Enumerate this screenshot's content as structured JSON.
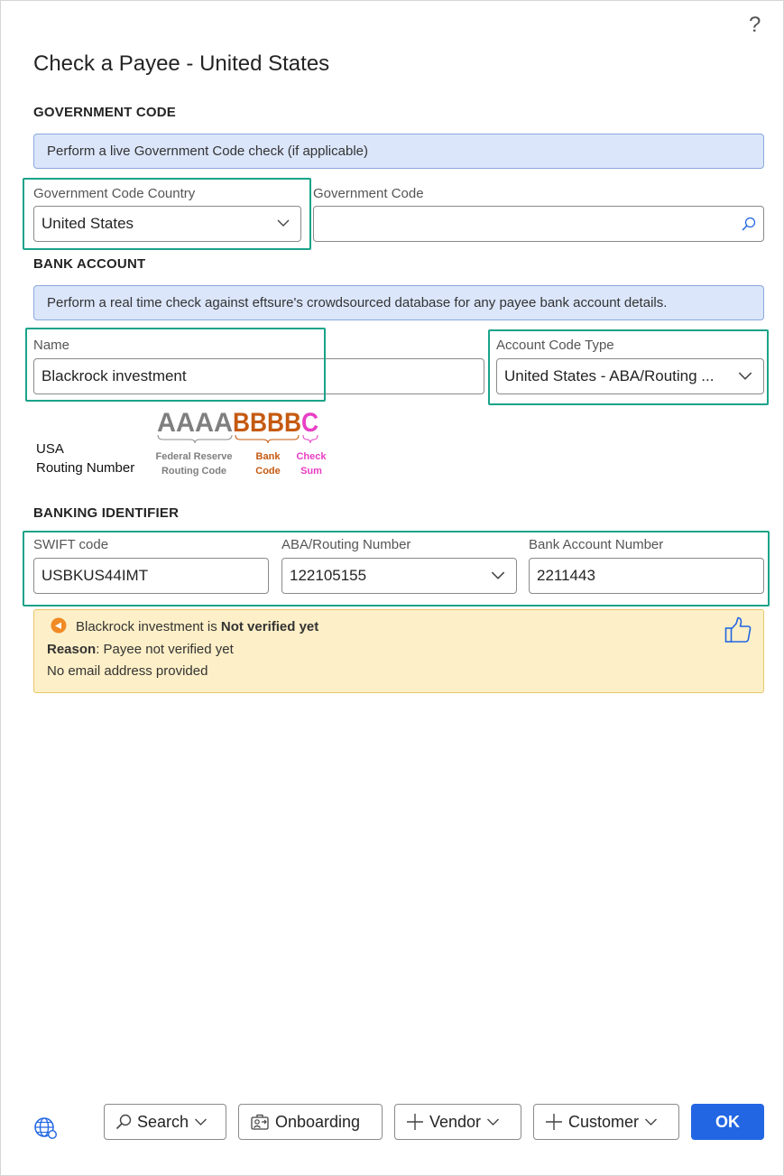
{
  "dialog": {
    "help_glyph": "?",
    "title": "Check a Payee - United States"
  },
  "government": {
    "section_title": "GOVERNMENT CODE",
    "banner": "Perform a live Government Code check (if applicable)",
    "country_label": "Government Code Country",
    "country_value": "United States",
    "code_label": "Government Code",
    "code_value": ""
  },
  "bank": {
    "section_title": "BANK ACCOUNT",
    "banner": "Perform a real time check against eftsure's crowdsourced database for any payee bank account details.",
    "name_label": "Name",
    "name_value": "Blackrock investment",
    "account_type_label": "Account Code Type",
    "account_type_value": "United States - ABA/Routing ..."
  },
  "routing_diagram": {
    "country_label": "USA",
    "number_label": "Routing Number",
    "part_a": "AAAA",
    "part_b": "BBBB",
    "part_c": "C",
    "caption_a_1": "Federal Reserve",
    "caption_a_2": "Routing Code",
    "caption_b_1": "Bank",
    "caption_b_2": "Code",
    "caption_c_1": "Check",
    "caption_c_2": "Sum",
    "colors": {
      "a": "#7f7f7f",
      "b": "#c55a11",
      "c": "#e83ec4"
    }
  },
  "identifier": {
    "section_title": "BANKING IDENTIFIER",
    "swift_label": "SWIFT code",
    "swift_value": "USBKUS44IMT",
    "aba_label": "ABA/Routing Number",
    "aba_value": "122105155",
    "account_label": "Bank Account Number",
    "account_value": "2211443"
  },
  "verification": {
    "name": "Blackrock investment",
    "is_text": " is ",
    "status": "Not verified yet",
    "reason_label": "Reason",
    "reason_text": ": Payee not verified yet",
    "email_note": "No email address provided",
    "icons": [
      "warning-icon",
      "thumbs-up-icon"
    ]
  },
  "footer": {
    "search_label": "Search",
    "onboarding_label": "Onboarding",
    "vendor_label": "Vendor",
    "customer_label": "Customer",
    "ok_label": "OK",
    "icons": [
      "globe-icon",
      "search-icon",
      "onboarding-icon",
      "plus-icon",
      "chevron-down-icon"
    ]
  },
  "colors": {
    "accent": "#2266e3",
    "highlight_box": "#1aa38a",
    "info_banner": "#dbe6fb",
    "warning_banner": "#fdefc7"
  }
}
